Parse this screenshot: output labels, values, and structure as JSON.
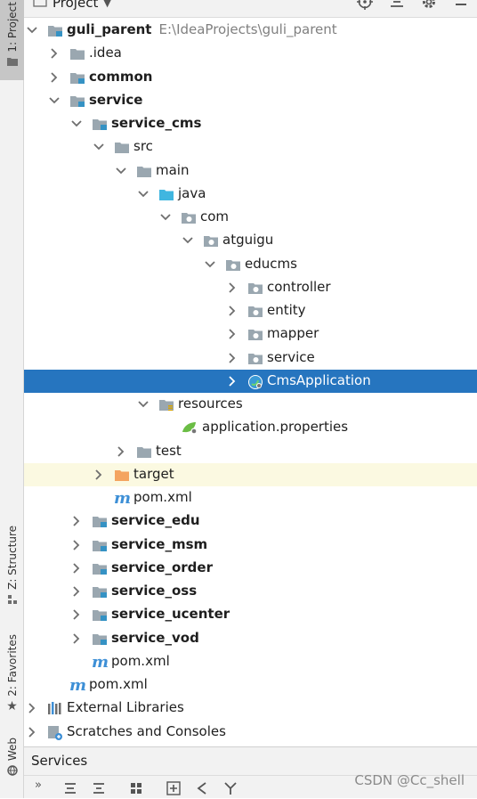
{
  "header": {
    "title": "Project"
  },
  "left_strip": {
    "project_tab": "1: Project",
    "structure_tab": "Z: Structure",
    "favorites_tab": "2: Favorites",
    "web_tab": "Web"
  },
  "tree": [
    {
      "label": "guli_parent",
      "path": "E:\\IdeaProjects\\guli_parent",
      "level": 0,
      "expanded": true,
      "icon": "module-folder-icon",
      "bold": true
    },
    {
      "label": ".idea",
      "level": 1,
      "expanded": false,
      "icon": "folder-icon"
    },
    {
      "label": "common",
      "level": 1,
      "expanded": false,
      "icon": "module-folder-icon",
      "bold": true
    },
    {
      "label": "service",
      "level": 1,
      "expanded": true,
      "icon": "module-folder-icon",
      "bold": true
    },
    {
      "label": "service_cms",
      "level": 2,
      "expanded": true,
      "icon": "module-folder-icon",
      "bold": true
    },
    {
      "label": "src",
      "level": 3,
      "expanded": true,
      "icon": "folder-icon"
    },
    {
      "label": "main",
      "level": 4,
      "expanded": true,
      "icon": "folder-icon"
    },
    {
      "label": "java",
      "level": 5,
      "expanded": true,
      "icon": "source-folder-icon"
    },
    {
      "label": "com",
      "level": 6,
      "expanded": true,
      "icon": "package-icon"
    },
    {
      "label": "atguigu",
      "level": 7,
      "expanded": true,
      "icon": "package-icon"
    },
    {
      "label": "educms",
      "level": 8,
      "expanded": true,
      "icon": "package-icon"
    },
    {
      "label": "controller",
      "level": 9,
      "expanded": false,
      "icon": "package-icon"
    },
    {
      "label": "entity",
      "level": 9,
      "expanded": false,
      "icon": "package-icon"
    },
    {
      "label": "mapper",
      "level": 9,
      "expanded": false,
      "icon": "package-icon"
    },
    {
      "label": "service",
      "level": 9,
      "expanded": false,
      "icon": "package-icon"
    },
    {
      "label": "CmsApplication",
      "level": 9,
      "expanded": false,
      "icon": "spring-class-icon",
      "selected": true
    },
    {
      "label": "resources",
      "level": 5,
      "expanded": true,
      "icon": "resources-folder-icon"
    },
    {
      "label": "application.properties",
      "level": 6,
      "icon": "spring-properties-icon"
    },
    {
      "label": "test",
      "level": 4,
      "expanded": false,
      "icon": "folder-icon"
    },
    {
      "label": "target",
      "level": 3,
      "expanded": false,
      "icon": "excluded-folder-icon",
      "excluded": true
    },
    {
      "label": "pom.xml",
      "level": 3,
      "icon": "maven-icon"
    },
    {
      "label": "service_edu",
      "level": 2,
      "expanded": false,
      "icon": "module-folder-icon",
      "bold": true
    },
    {
      "label": "service_msm",
      "level": 2,
      "expanded": false,
      "icon": "module-folder-icon",
      "bold": true
    },
    {
      "label": "service_order",
      "level": 2,
      "expanded": false,
      "icon": "module-folder-icon",
      "bold": true
    },
    {
      "label": "service_oss",
      "level": 2,
      "expanded": false,
      "icon": "module-folder-icon",
      "bold": true
    },
    {
      "label": "service_ucenter",
      "level": 2,
      "expanded": false,
      "icon": "module-folder-icon",
      "bold": true
    },
    {
      "label": "service_vod",
      "level": 2,
      "expanded": false,
      "icon": "module-folder-icon",
      "bold": true
    },
    {
      "label": "pom.xml",
      "level": 2,
      "icon": "maven-icon"
    },
    {
      "label": "pom.xml",
      "level": 1,
      "icon": "maven-icon"
    },
    {
      "label": "External Libraries",
      "level": 0,
      "expanded": false,
      "icon": "libraries-icon"
    },
    {
      "label": "Scratches and Consoles",
      "level": 0,
      "expanded": false,
      "icon": "scratches-icon"
    }
  ],
  "services": {
    "title": "Services"
  },
  "watermark": "CSDN @Cc_shell",
  "colors": {
    "selection": "#2675bf",
    "excluded_row": "#fbf9e1",
    "folder": "#9aa7b0",
    "module_badge": "#3592c4",
    "source_folder": "#40b6e0",
    "excluded_folder": "#f4a460"
  }
}
